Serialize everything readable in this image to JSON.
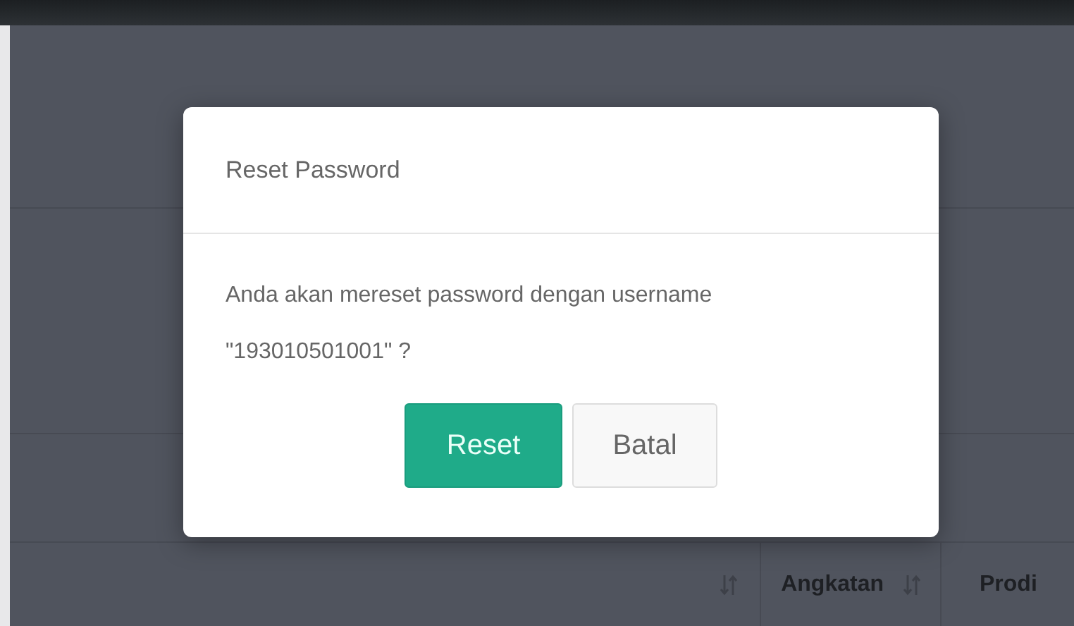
{
  "table": {
    "columns": [
      {
        "sortable": true
      },
      {
        "label": "Angkatan",
        "sortable": true
      },
      {
        "label": "Prodi",
        "sortable": false
      }
    ]
  },
  "dialog": {
    "title": "Reset Password",
    "message": "Anda akan mereset password dengan username \"193010501001\" ?",
    "buttons": [
      {
        "label": "Reset",
        "kind": "primary"
      },
      {
        "label": "Batal",
        "kind": "default"
      }
    ]
  }
}
